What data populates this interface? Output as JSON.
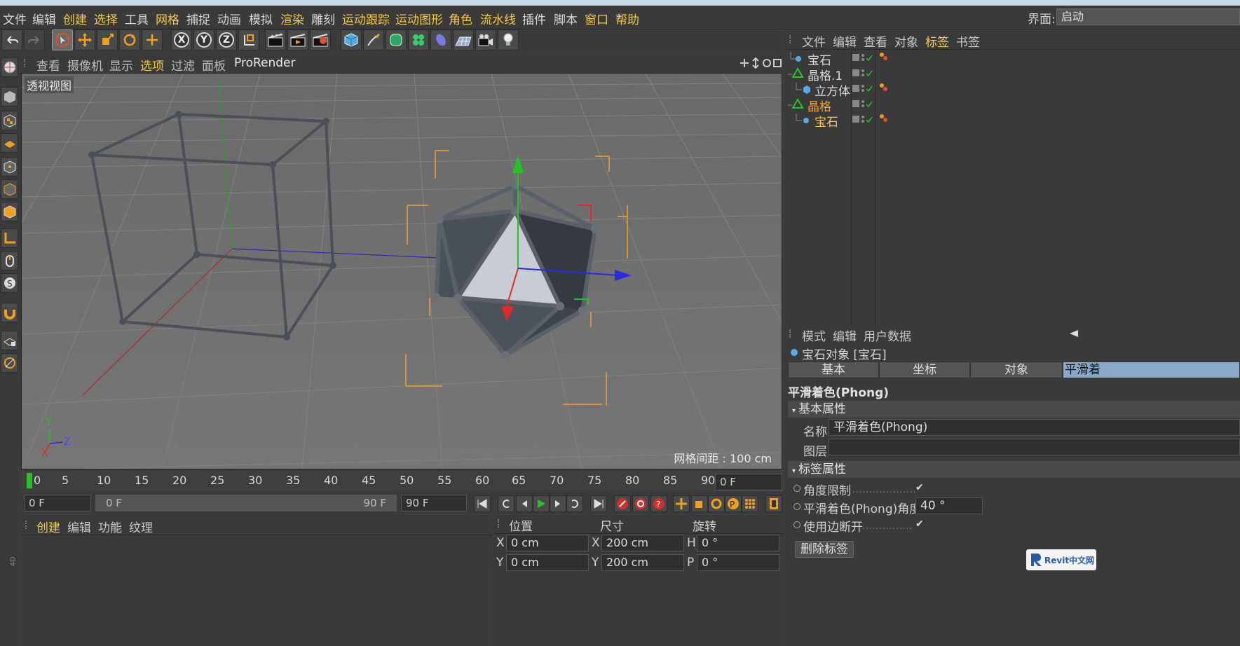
{
  "menu": {
    "items": [
      {
        "label": "文件",
        "hl": false
      },
      {
        "label": "编辑",
        "hl": false
      },
      {
        "label": "创建",
        "hl": true
      },
      {
        "label": "选择",
        "hl": true
      },
      {
        "label": "工具",
        "hl": false
      },
      {
        "label": "网格",
        "hl": true
      },
      {
        "label": "捕捉",
        "hl": false
      },
      {
        "label": "动画",
        "hl": false
      },
      {
        "label": "模拟",
        "hl": false
      },
      {
        "label": "渲染",
        "hl": true
      },
      {
        "label": "雕刻",
        "hl": false
      },
      {
        "label": "运动跟踪",
        "hl": true
      },
      {
        "label": "运动图形",
        "hl": true
      },
      {
        "label": "角色",
        "hl": true
      },
      {
        "label": "流水线",
        "hl": true
      },
      {
        "label": "插件",
        "hl": false
      },
      {
        "label": "脚本",
        "hl": false
      },
      {
        "label": "窗口",
        "hl": true
      },
      {
        "label": "帮助",
        "hl": true
      }
    ],
    "layout_label": "界面:",
    "layout_value": "启动"
  },
  "toolbar": {
    "axis_x": "X",
    "axis_y": "Y",
    "axis_z": "Z"
  },
  "viewport": {
    "menu": [
      "查看",
      "摄像机",
      "显示",
      "选项",
      "过滤",
      "面板",
      "ProRender"
    ],
    "label": "透视视图",
    "grid_info": "网格间距 : 100 cm",
    "axis_y": "Y",
    "axis_z": "Z",
    "axis_x": "X"
  },
  "timeline": {
    "ticks": [
      "0",
      "5",
      "10",
      "15",
      "20",
      "25",
      "30",
      "35",
      "40",
      "45",
      "50",
      "55",
      "60",
      "65",
      "70",
      "75",
      "80",
      "85",
      "90"
    ],
    "current_frame": "0 F"
  },
  "playbar": {
    "start": "0 F",
    "range_start": "0 F",
    "range_end": "90 F",
    "end": "90 F"
  },
  "material_panel": {
    "menu": [
      "创建",
      "编辑",
      "功能",
      "纹理"
    ]
  },
  "coord_panel": {
    "headers": [
      "位置",
      "尺寸",
      "旋转"
    ],
    "rows": [
      {
        "a": "X",
        "pos": "0 cm",
        "b": "X",
        "size": "200 cm",
        "c": "H",
        "rot": "0 °"
      },
      {
        "a": "Y",
        "pos": "0 cm",
        "b": "Y",
        "size": "200 cm",
        "c": "P",
        "rot": "0 °"
      }
    ]
  },
  "object_panel": {
    "menu": [
      "文件",
      "编辑",
      "查看",
      "对象",
      "标签",
      "书签"
    ],
    "objects": [
      {
        "name": "宝石",
        "color": "normal"
      },
      {
        "name": "晶格.1",
        "color": "normal"
      },
      {
        "name": "立方体",
        "color": "normal"
      },
      {
        "name": "晶格",
        "color": "orange"
      },
      {
        "name": "宝石",
        "color": "yellow"
      }
    ]
  },
  "attr_panel": {
    "menu": [
      "模式",
      "编辑",
      "用户数据"
    ],
    "object_title": "宝石对象 [宝石]",
    "tabs": [
      "基本",
      "坐标",
      "对象",
      "平滑着"
    ],
    "section_title": "平滑着色(Phong)",
    "basic_header": "基本属性",
    "name_label": "名称",
    "name_value": "平滑着色(Phong)",
    "layer_label": "图层",
    "tag_header": "标签属性",
    "angle_limit_label": "角度限制",
    "phong_angle_label": "平滑着色(Phong)角度",
    "phong_angle_value": "40 °",
    "edge_break_label": "使用边断开",
    "delete_tag_label": "删除标签"
  },
  "watermark": "Revit中文网",
  "version_tag": "4D"
}
